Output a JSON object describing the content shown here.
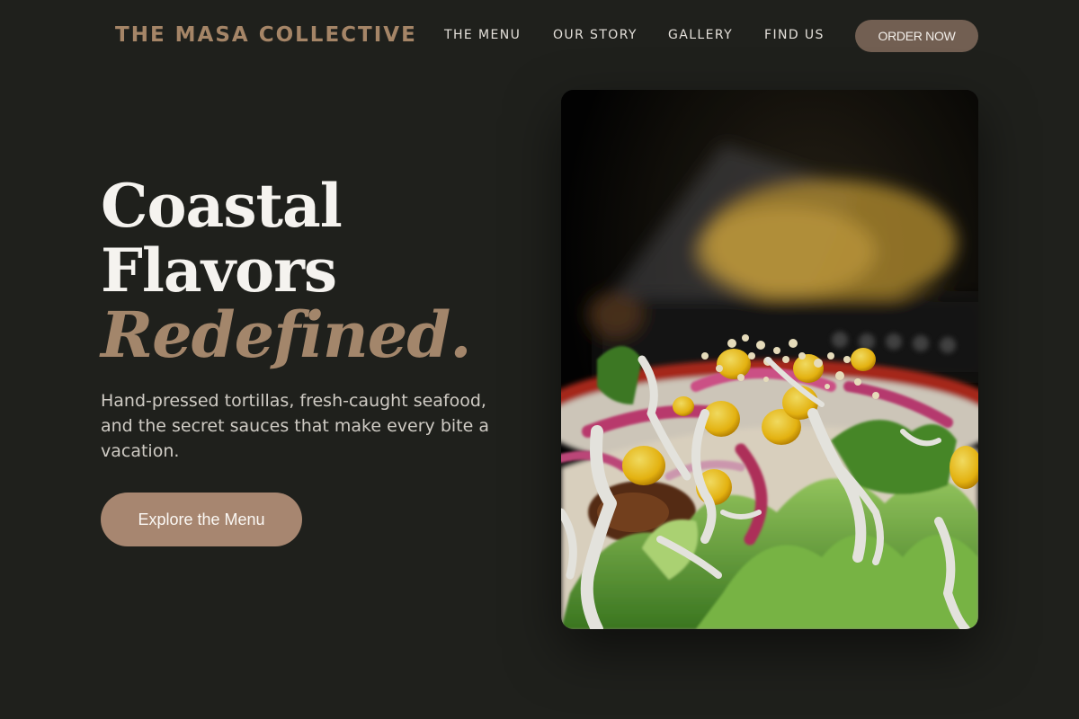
{
  "brand": {
    "name": "THE MASA COLLECTIVE"
  },
  "nav": {
    "links": [
      {
        "label": "THE MENU"
      },
      {
        "label": "OUR STORY"
      },
      {
        "label": "GALLERY"
      },
      {
        "label": "FIND US"
      }
    ],
    "cta_label": "ORDER NOW"
  },
  "hero": {
    "title_line1": "Coastal",
    "title_line2": "Flavors",
    "title_accent": "Redefined.",
    "subtitle": "Hand-pressed tortillas, fresh-caught seafood, and the secret sauces that make every bite a vacation.",
    "cta_label": "Explore the Menu"
  },
  "photo": {
    "subject": "taco-photo"
  },
  "colors": {
    "background": "#1f201c",
    "brand": "#a58567",
    "accent_text": "#a3866b",
    "order_button": "#725f52",
    "cta_button": "#a78670"
  }
}
